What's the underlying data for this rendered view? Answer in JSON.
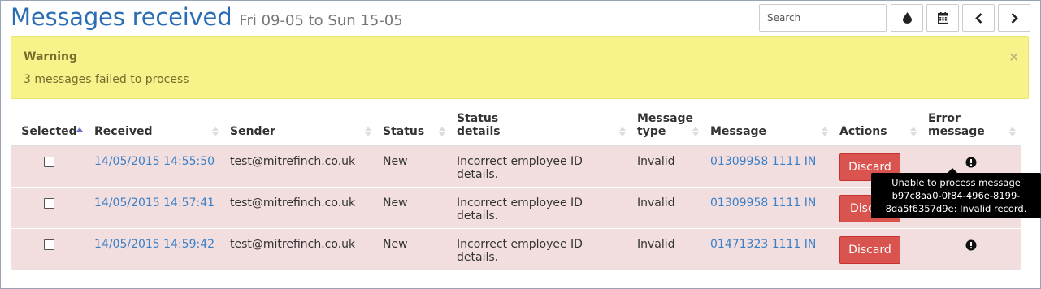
{
  "header": {
    "title": "Messages received",
    "date_range": "Fri 09-05 to Sun 15-05"
  },
  "toolbar": {
    "search_placeholder": "Search",
    "buttons": [
      "tint-icon",
      "calendar-icon",
      "chevron-left-icon",
      "chevron-right-icon"
    ]
  },
  "alert": {
    "title": "Warning",
    "text": "3 messages failed to process",
    "close": "×"
  },
  "table": {
    "headers": {
      "selected": "Selected",
      "received": "Received",
      "sender": "Sender",
      "status": "Status",
      "status_details": "Status details",
      "message_type": "Message type",
      "message": "Message",
      "actions": "Actions",
      "error_message": "Error message"
    },
    "sorted_column": "selected",
    "sort_direction": "ascending",
    "rows": [
      {
        "selected": false,
        "received": "14/05/2015 14:55:50",
        "sender": "test@mitrefinch.co.uk",
        "status": "New",
        "status_details": "Incorrect employee ID details.",
        "message_type": "Invalid",
        "message": "01309958 1111 IN",
        "action": "Discard"
      },
      {
        "selected": false,
        "received": "14/05/2015 14:57:41",
        "sender": "test@mitrefinch.co.uk",
        "status": "New",
        "status_details": "Incorrect employee ID details.",
        "message_type": "Invalid",
        "message": "01309958 1111 IN",
        "action": "Disc"
      },
      {
        "selected": false,
        "received": "14/05/2015 14:59:42",
        "sender": "test@mitrefinch.co.uk",
        "status": "New",
        "status_details": "Incorrect employee ID details.",
        "message_type": "Invalid",
        "message": "01471323 1111 IN",
        "action": "Discard"
      }
    ]
  },
  "tooltip": {
    "lines": [
      "Unable to process message",
      "b97c8aa0-0f84-496e-8199-",
      "8da5f6357d9e: Invalid record."
    ]
  },
  "colors": {
    "title": "#2a6db5",
    "link": "#3a80c9",
    "row_error_bg": "#f2dede",
    "alert_bg": "#f7f38a",
    "danger": "#d9534f"
  }
}
